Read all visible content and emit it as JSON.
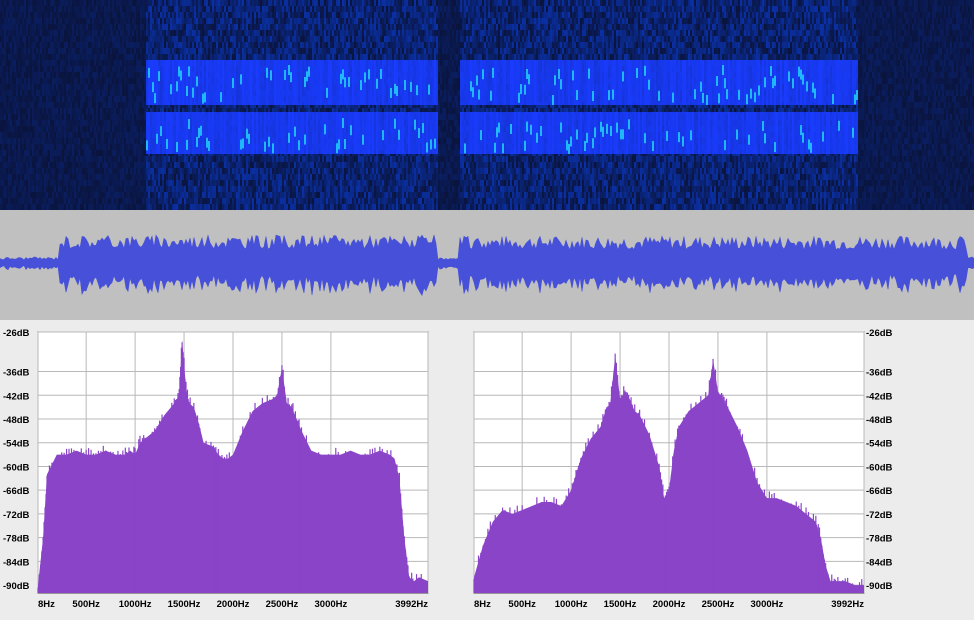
{
  "colors": {
    "spectrogram_bg": "#020630",
    "spectrogram_band": "#1a3cff",
    "spectrogram_hot": "#22d8ff",
    "waveform_bg": "#c0c0c0",
    "waveform_fill": "#4650d8",
    "spectrum_fill": "#8a44c8",
    "grid": "#b8b8b8"
  },
  "chart_data": [
    {
      "type": "area",
      "panel": "left-spectrum",
      "x_tick_labels": [
        "8Hz",
        "500Hz",
        "1000Hz",
        "1500Hz",
        "2000Hz",
        "2500Hz",
        "3000Hz",
        "3992Hz"
      ],
      "x_tick_values": [
        8,
        500,
        1000,
        1500,
        2000,
        2500,
        3000,
        3992
      ],
      "y_tick_labels": [
        "-26dB",
        "-36dB",
        "-42dB",
        "-48dB",
        "-54dB",
        "-60dB",
        "-66dB",
        "-72dB",
        "-78dB",
        "-84dB",
        "-90dB"
      ],
      "y_tick_values": [
        -26,
        -36,
        -42,
        -48,
        -54,
        -60,
        -66,
        -72,
        -78,
        -84,
        -90
      ],
      "y_axis_side": "left",
      "xlim": [
        8,
        3992
      ],
      "ylim": [
        -92,
        -26
      ],
      "grid": true,
      "x": [
        8,
        60,
        100,
        200,
        300,
        400,
        500,
        600,
        700,
        800,
        900,
        950,
        1000,
        1050,
        1100,
        1200,
        1300,
        1400,
        1450,
        1480,
        1520,
        1550,
        1600,
        1650,
        1700,
        1800,
        1850,
        1900,
        1950,
        2000,
        2100,
        2200,
        2300,
        2400,
        2450,
        2500,
        2550,
        2600,
        2650,
        2700,
        2800,
        2900,
        3000,
        3100,
        3200,
        3300,
        3400,
        3500,
        3600,
        3650,
        3700,
        3750,
        3800,
        3850,
        3900,
        3992
      ],
      "y": [
        -90,
        -78,
        -62,
        -57,
        -57,
        -56,
        -57,
        -57,
        -56,
        -57,
        -57,
        -56,
        -57,
        -54,
        -53,
        -51,
        -47,
        -44,
        -42,
        -28,
        -40,
        -44,
        -45,
        -49,
        -54,
        -55,
        -57,
        -58,
        -58,
        -57,
        -51,
        -46,
        -44,
        -43,
        -42,
        -35,
        -44,
        -45,
        -48,
        -51,
        -56,
        -57,
        -57,
        -57,
        -56,
        -57,
        -57,
        -56,
        -57,
        -58,
        -63,
        -78,
        -88,
        -89,
        -88,
        -89
      ]
    },
    {
      "type": "area",
      "panel": "right-spectrum",
      "x_tick_labels": [
        "8Hz",
        "500Hz",
        "1000Hz",
        "1500Hz",
        "2000Hz",
        "2500Hz",
        "3000Hz",
        "3992Hz"
      ],
      "x_tick_values": [
        8,
        500,
        1000,
        1500,
        2000,
        2500,
        3000,
        3992
      ],
      "y_tick_labels": [
        "-26dB",
        "-36dB",
        "-42dB",
        "-48dB",
        "-54dB",
        "-60dB",
        "-66dB",
        "-72dB",
        "-78dB",
        "-84dB",
        "-90dB"
      ],
      "y_tick_values": [
        -26,
        -36,
        -42,
        -48,
        -54,
        -60,
        -66,
        -72,
        -78,
        -84,
        -90
      ],
      "y_axis_side": "right",
      "xlim": [
        8,
        3992
      ],
      "ylim": [
        -92,
        -26
      ],
      "grid": true,
      "x": [
        8,
        100,
        200,
        300,
        400,
        500,
        600,
        700,
        800,
        900,
        1000,
        1050,
        1100,
        1200,
        1300,
        1350,
        1400,
        1450,
        1500,
        1550,
        1600,
        1650,
        1700,
        1800,
        1900,
        1950,
        2000,
        2050,
        2100,
        2200,
        2300,
        2400,
        2450,
        2500,
        2550,
        2600,
        2700,
        2800,
        2900,
        3000,
        3100,
        3200,
        3300,
        3400,
        3500,
        3550,
        3600,
        3650,
        3700,
        3800,
        3900,
        3992
      ],
      "y": [
        -88,
        -80,
        -74,
        -71,
        -72,
        -71,
        -70,
        -69,
        -69,
        -70,
        -66,
        -62,
        -58,
        -53,
        -50,
        -46,
        -44,
        -32,
        -43,
        -41,
        -43,
        -46,
        -47,
        -52,
        -60,
        -68,
        -66,
        -56,
        -50,
        -46,
        -44,
        -42,
        -33,
        -41,
        -43,
        -45,
        -50,
        -56,
        -64,
        -68,
        -68,
        -69,
        -70,
        -72,
        -74,
        -78,
        -85,
        -89,
        -89,
        -89,
        -90,
        -90
      ]
    }
  ]
}
